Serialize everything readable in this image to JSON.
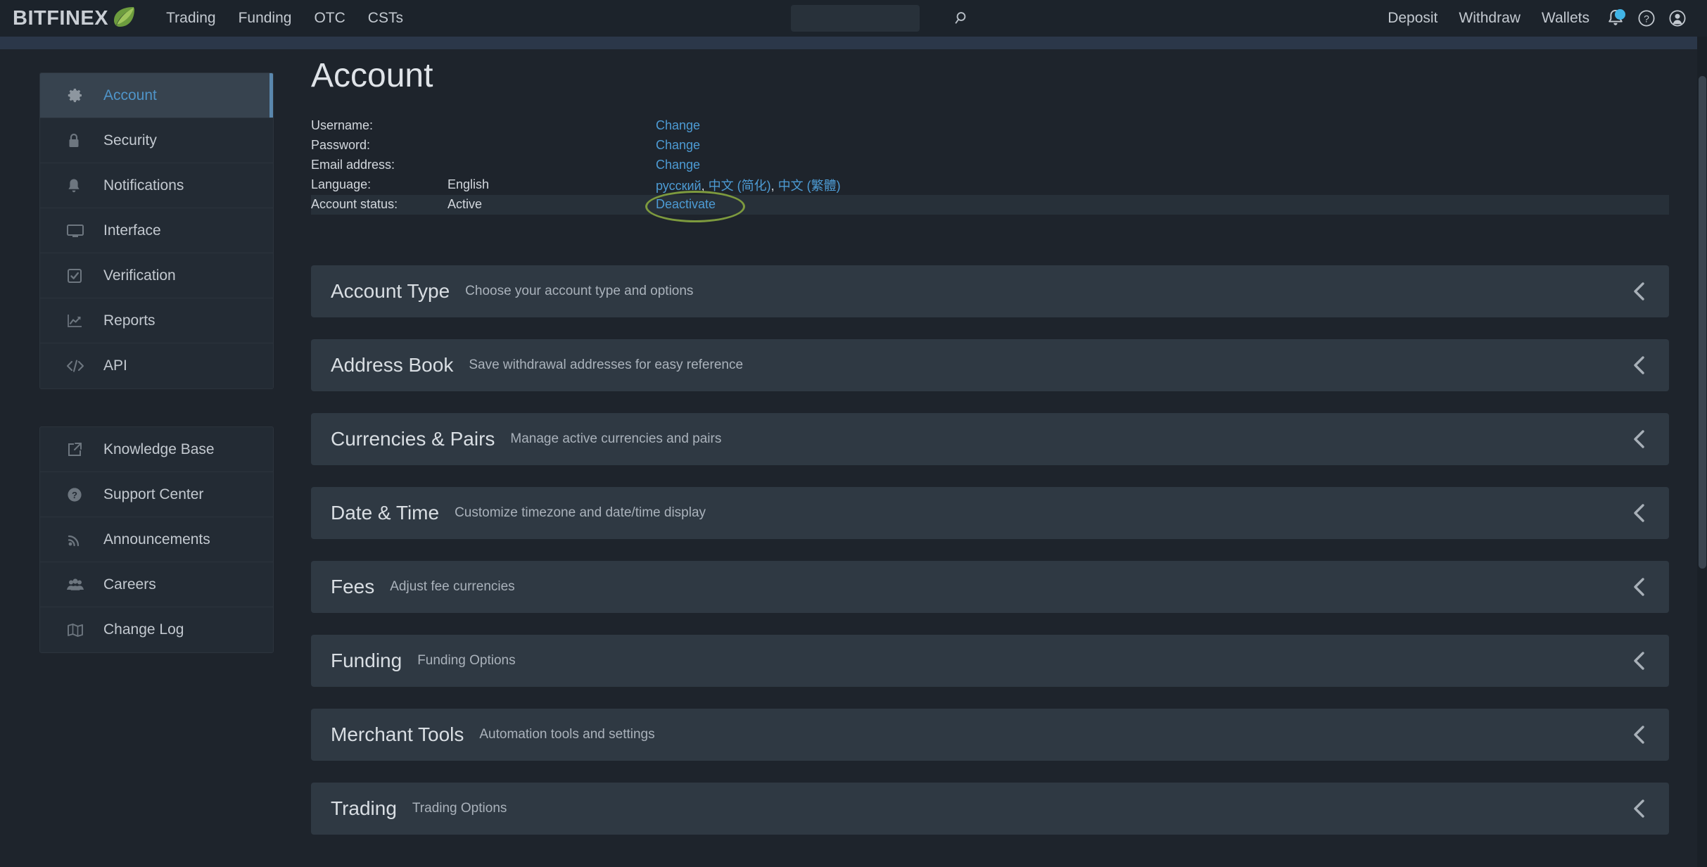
{
  "header": {
    "brand": "BITFINEX",
    "brand_icon": "leaf-icon",
    "nav_left": [
      {
        "label": "Trading"
      },
      {
        "label": "Funding"
      },
      {
        "label": "OTC"
      },
      {
        "label": "CSTs"
      }
    ],
    "search": {
      "value": "",
      "placeholder": "",
      "icon": "search-icon"
    },
    "nav_right": [
      {
        "label": "Deposit"
      },
      {
        "label": "Withdraw"
      },
      {
        "label": "Wallets"
      }
    ],
    "icons": [
      {
        "name": "bell-icon",
        "badge": true,
        "badge_color": "#41b4e6"
      },
      {
        "name": "help-circle-icon"
      },
      {
        "name": "user-avatar-icon"
      }
    ]
  },
  "sidebar": {
    "group_primary": [
      {
        "label": "Account",
        "icon": "gear-icon",
        "active": true
      },
      {
        "label": "Security",
        "icon": "lock-icon",
        "active": false
      },
      {
        "label": "Notifications",
        "icon": "bell-icon",
        "active": false
      },
      {
        "label": "Interface",
        "icon": "monitor-icon",
        "active": false
      },
      {
        "label": "Verification",
        "icon": "checkbox-check-icon",
        "active": false
      },
      {
        "label": "Reports",
        "icon": "chart-line-icon",
        "active": false
      },
      {
        "label": "API",
        "icon": "code-brackets-icon",
        "active": false
      }
    ],
    "group_secondary": [
      {
        "label": "Knowledge Base",
        "icon": "external-link-icon"
      },
      {
        "label": "Support Center",
        "icon": "question-circle-icon"
      },
      {
        "label": "Announcements",
        "icon": "rss-icon"
      },
      {
        "label": "Careers",
        "icon": "people-group-icon"
      },
      {
        "label": "Change Log",
        "icon": "map-book-icon"
      }
    ]
  },
  "main": {
    "title": "Account",
    "account_rows": [
      {
        "key": "Username:",
        "value": "",
        "action": "Change",
        "highlight": false
      },
      {
        "key": "Password:",
        "value": "",
        "action": "Change",
        "highlight": false
      },
      {
        "key": "Email address:",
        "value": "",
        "action": "Change",
        "highlight": false
      },
      {
        "key": "Language:",
        "value": "English",
        "action": "",
        "highlight": false
      },
      {
        "key": "Account status:",
        "value": "Active",
        "action": "Deactivate",
        "highlight": true
      }
    ],
    "language_links": [
      {
        "label": "русский"
      },
      {
        "label": "中文 (简化)"
      },
      {
        "label": "中文 (繁體)"
      }
    ],
    "language_separator": ",",
    "annotation": {
      "type": "ellipse-highlight",
      "target": "Deactivate",
      "color": "#7d9a3e"
    },
    "panels": [
      {
        "title": "Account Type",
        "desc": "Choose your account type and options",
        "chevron": "chevron-left-icon"
      },
      {
        "title": "Address Book",
        "desc": "Save withdrawal addresses for easy reference",
        "chevron": "chevron-left-icon"
      },
      {
        "title": "Currencies & Pairs",
        "desc": "Manage active currencies and pairs",
        "chevron": "chevron-left-icon"
      },
      {
        "title": "Date & Time",
        "desc": "Customize timezone and date/time display",
        "chevron": "chevron-left-icon"
      },
      {
        "title": "Fees",
        "desc": "Adjust fee currencies",
        "chevron": "chevron-left-icon"
      },
      {
        "title": "Funding",
        "desc": "Funding Options",
        "chevron": "chevron-left-icon"
      },
      {
        "title": "Merchant Tools",
        "desc": "Automation tools and settings",
        "chevron": "chevron-left-icon"
      },
      {
        "title": "Trading",
        "desc": "Trading Options",
        "chevron": "chevron-left-icon"
      }
    ]
  },
  "colors": {
    "page_bg": "#1e242c",
    "header_bg": "#1c232b",
    "strip_bg": "#2b3749",
    "panel_bg": "#2f3943",
    "sidebar_bg": "#232b34",
    "sidebar_active_bg": "#37434f",
    "accent_link": "#4d9bd4",
    "accent_active_border": "#5a87ad",
    "annotation_green": "#7d9a3e",
    "brand_leaf_green": "#76a240"
  }
}
